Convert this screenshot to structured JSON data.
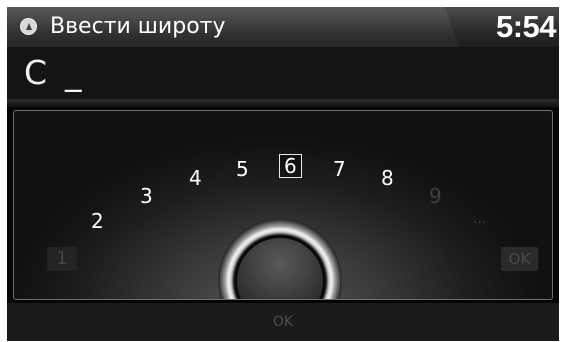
{
  "header": {
    "title": "Ввести широту",
    "clock": "5:54",
    "icon": "navigation-icon"
  },
  "input": {
    "value": "С",
    "cursor": "_"
  },
  "keypad": {
    "keys": [
      {
        "label": "1",
        "enabled": false
      },
      {
        "label": "2",
        "enabled": true
      },
      {
        "label": "3",
        "enabled": true
      },
      {
        "label": "4",
        "enabled": true
      },
      {
        "label": "5",
        "enabled": true
      },
      {
        "label": "6",
        "enabled": true,
        "selected": true
      },
      {
        "label": "7",
        "enabled": true
      },
      {
        "label": "8",
        "enabled": true
      },
      {
        "label": "9",
        "enabled": false
      },
      {
        "label": "...",
        "enabled": false
      }
    ],
    "ok_label": "OK"
  },
  "footer": {
    "ok_label": "OK"
  },
  "colors": {
    "background": "#060606",
    "text": "#ffffff",
    "disabled": "#3f3f3f"
  }
}
